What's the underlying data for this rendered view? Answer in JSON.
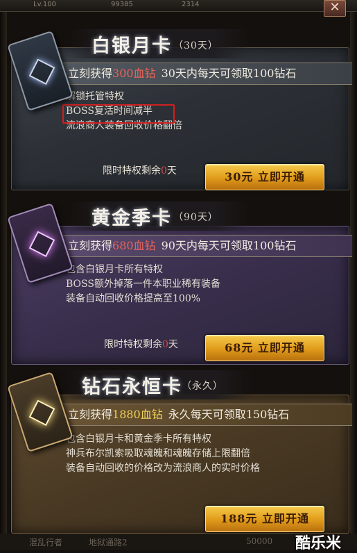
{
  "topbar": {
    "level": "Lv.100",
    "value1": "99385",
    "value2": "2314",
    "close_label": "✕"
  },
  "cards": [
    {
      "title": "白银月卡",
      "duration": "（30天）",
      "banner": {
        "prefix": "立刻获得",
        "amount": "300血钻",
        "suffix": "30天内每天可领取100钻石"
      },
      "features": [
        "解锁托管特权",
        "BOSS复活时间减半",
        "流浪商人装备回收价格翻倍"
      ],
      "remaining": {
        "prefix": "限时特权剩余",
        "days": "0",
        "suffix": "天"
      },
      "button": "30元 立即开通",
      "accent": "#e8655a"
    },
    {
      "title": "黄金季卡",
      "duration": "（90天）",
      "banner": {
        "prefix": "立刻获得",
        "amount": "680血钻",
        "suffix": "90天内每天可领取100钻石"
      },
      "features": [
        "包含白银月卡所有特权",
        "BOSS额外掉落一件本职业稀有装备",
        "装备自动回收价格提高至100%"
      ],
      "remaining": {
        "prefix": "限时特权剩余",
        "days": "0",
        "suffix": "天"
      },
      "button": "68元 立即开通",
      "accent": "#e8655a"
    },
    {
      "title": "钻石永恒卡",
      "duration": "（永久）",
      "banner": {
        "prefix": "立刻获得",
        "amount": "1880血钻",
        "suffix": "永久每天可领取150钻石"
      },
      "features": [
        "包含白银月卡和黄金季卡所有特权",
        "神兵布尔凯索吸取魂魄和魂魄存储上限翻倍",
        "装备自动回收的价格改为流浪商人的实时价格"
      ],
      "button": "188元 立即开通",
      "accent": "#f0d25a"
    }
  ],
  "bottom": {
    "left": "混乱行者",
    "middle": "地狱通路2",
    "right": "50000"
  },
  "watermark": "酷乐米"
}
